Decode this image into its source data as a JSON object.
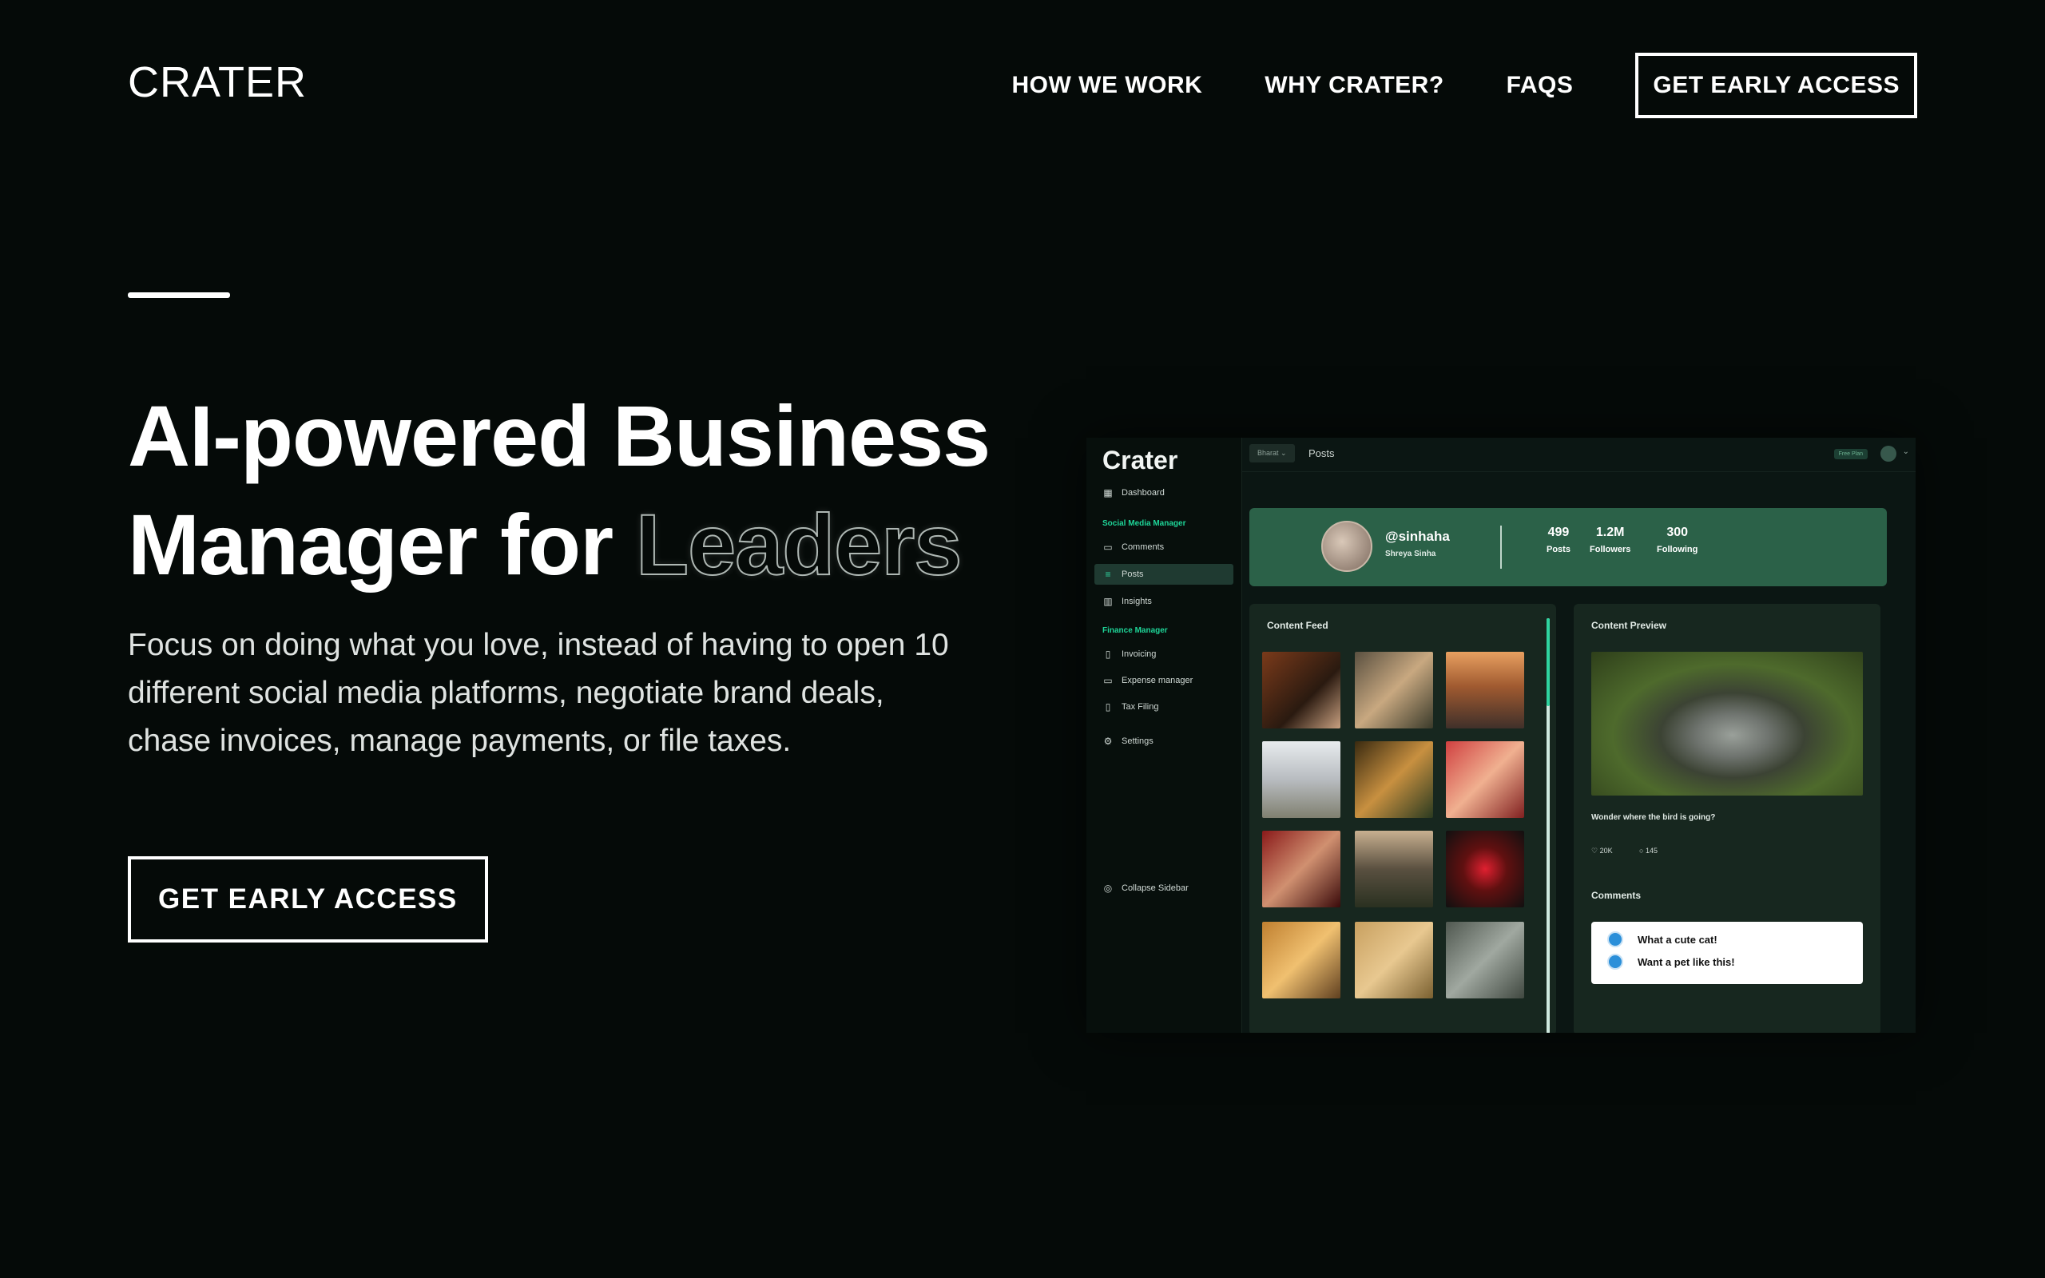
{
  "brand": "CRATER",
  "nav": {
    "items": [
      "HOW WE WORK",
      "WHY CRATER?",
      "FAQS"
    ],
    "cta": "GET EARLY ACCESS"
  },
  "hero": {
    "headline_line1": "AI-powered Business",
    "headline_line2_prefix": "Manager for ",
    "headline_outline_word": "Leaders",
    "subtitle": "Focus on doing what you love, instead of having to open 10 different social media platforms, negotiate brand deals, chase invoices, manage payments, or file taxes.",
    "cta": "GET EARLY ACCESS"
  },
  "mockup": {
    "brand": "Crater",
    "sidebar": {
      "dashboard": "Dashboard",
      "section_social": "Social Media Manager",
      "comments": "Comments",
      "posts": "Posts",
      "insights": "Insights",
      "section_finance": "Finance Manager",
      "invoicing": "Invoicing",
      "expense": "Expense manager",
      "tax": "Tax Filing",
      "settings": "Settings",
      "collapse": "Collapse Sidebar"
    },
    "topbar": {
      "account": "Bharat ⌄",
      "title": "Posts",
      "plan": "Free Plan"
    },
    "profile": {
      "handle": "@sinhaha",
      "name": "Shreya Sinha",
      "stats": [
        {
          "value": "499",
          "label": "Posts"
        },
        {
          "value": "1.2M",
          "label": "Followers"
        },
        {
          "value": "300",
          "label": "Following"
        }
      ]
    },
    "feed_title": "Content Feed",
    "preview": {
      "title": "Content Preview",
      "caption": "Wonder where the bird is going?",
      "likes": "20K",
      "comments_count": "145",
      "comments_title": "Comments",
      "comments": [
        "What a cute cat!",
        "Want a pet like this!"
      ]
    }
  }
}
